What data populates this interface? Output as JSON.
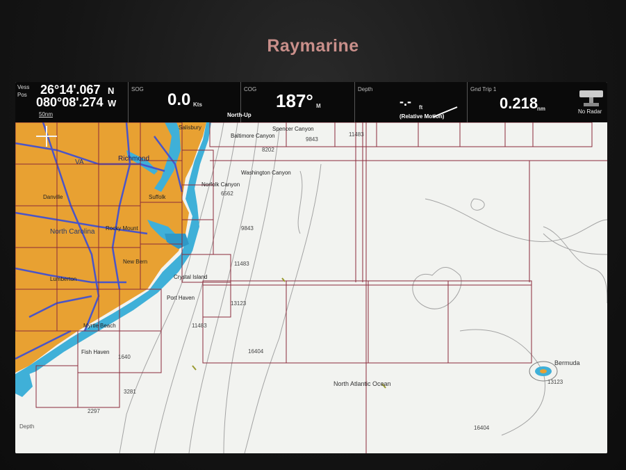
{
  "device": {
    "brand": "Raymarine"
  },
  "databar": {
    "position": {
      "label_top": "Vess",
      "label_bottom": "Pos",
      "latitude": "26°14'.067",
      "lat_hemisphere": "N",
      "longitude": "080°08'.274",
      "lon_hemisphere": "W"
    },
    "sog": {
      "label": "SOG",
      "value": "0.0",
      "unit": "Kts"
    },
    "cog": {
      "label": "COG",
      "value": "187°",
      "unit": "M"
    },
    "depth": {
      "label": "Depth",
      "value": "-.-",
      "unit": "ft"
    },
    "gnd_trip": {
      "label": "Gnd Trip 1",
      "value": "0.218",
      "unit": "nm"
    },
    "radar": {
      "label": "No Radar"
    }
  },
  "map": {
    "orientation": "North-Up",
    "motion_mode": "(Relative Motion)",
    "scale_label": "50nm",
    "places": {
      "va": "VA",
      "richmond": "Richmond",
      "north_carolina": "North Carolina",
      "rocky_mount": "Rocky Mount",
      "new_bern": "New Bern",
      "lumberton": "Lumberton",
      "danville": "Danville",
      "suffolk": "Suffolk",
      "salisbury": "Salisbury",
      "norfolk_canyon": "Norfolk Canyon",
      "baltimore_canyon": "Baltimore Canyon",
      "spencer_canyon": "Spencer Canyon",
      "washington_canyon": "Washington Canyon",
      "crystal_island": "Crystal Island",
      "myrtle_beach": "Myrtle Beach",
      "port_haven": "Port Haven",
      "fish_haven": "Fish Haven",
      "north_atlantic": "North Atlantic Ocean",
      "bermuda": "Bermuda",
      "depth_label": "Depth"
    },
    "soundings": [
      "9843",
      "11483",
      "8202",
      "6562",
      "9843",
      "11483",
      "13123",
      "11483",
      "16404",
      "1640",
      "3281",
      "2297",
      "16404",
      "13123"
    ]
  },
  "colors": {
    "land": "#e8a132",
    "shallow_water": "#3fb0d8",
    "chart_sea": "#f2f3f0",
    "boundary": "#8a2a3a",
    "road": "#4a55c8",
    "contour": "#9a9a9a"
  }
}
